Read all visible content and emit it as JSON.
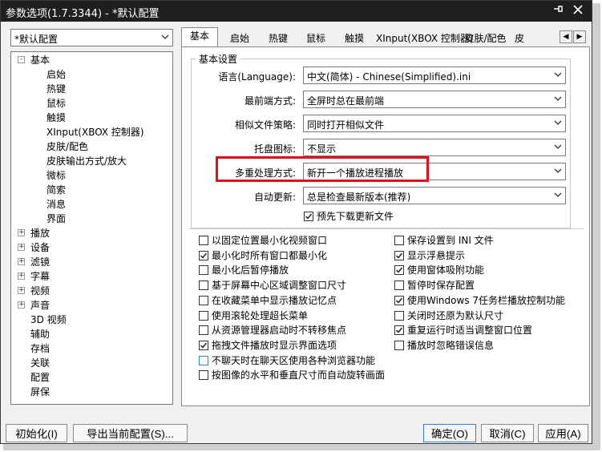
{
  "window": {
    "title": "参数选项(1.7.3344) - *默认配置",
    "pin_glyph": "‑❙",
    "close_glyph": "✕"
  },
  "profile": {
    "value": "*默认配置"
  },
  "tree": {
    "items": [
      {
        "label": "基本",
        "expander": "-",
        "level": 0
      },
      {
        "label": "启始",
        "level": 1
      },
      {
        "label": "热键",
        "level": 1
      },
      {
        "label": "鼠标",
        "level": 1
      },
      {
        "label": "触摸",
        "level": 1
      },
      {
        "label": "XInput(XBOX 控制器)",
        "level": 1
      },
      {
        "label": "皮肤/配色",
        "level": 1
      },
      {
        "label": "皮肤输出方式/放大",
        "level": 1
      },
      {
        "label": "微标",
        "level": 1
      },
      {
        "label": "简索",
        "level": 1
      },
      {
        "label": "消息",
        "level": 1
      },
      {
        "label": "界面",
        "level": 1
      },
      {
        "label": "播放",
        "expander": "+",
        "level": 0
      },
      {
        "label": "设备",
        "expander": "+",
        "level": 0
      },
      {
        "label": "滤镜",
        "expander": "+",
        "level": 0
      },
      {
        "label": "字幕",
        "expander": "+",
        "level": 0
      },
      {
        "label": "视频",
        "expander": "+",
        "level": 0
      },
      {
        "label": "声音",
        "expander": "+",
        "level": 0
      },
      {
        "label": "3D 视频",
        "level": 0
      },
      {
        "label": "辅助",
        "level": 0
      },
      {
        "label": "存档",
        "level": 0
      },
      {
        "label": "关联",
        "level": 0
      },
      {
        "label": "配置",
        "level": 0
      },
      {
        "label": "屏保",
        "level": 0
      }
    ]
  },
  "tabs": [
    {
      "label": "基本",
      "active": true
    },
    {
      "label": "启始"
    },
    {
      "label": "热键"
    },
    {
      "label": "鼠标"
    },
    {
      "label": "触摸"
    },
    {
      "label": "XInput(XBOX 控制器)"
    },
    {
      "label": "皮肤/配色"
    },
    {
      "label": "皮"
    }
  ],
  "tabnav": {
    "prev": "◀",
    "next": "▶"
  },
  "basic": {
    "group_title": "基本设置",
    "fields": [
      {
        "label": "语言(Language):",
        "value": "中文(简体) - Chinese(Simplified).ini"
      },
      {
        "label": "最前端方式:",
        "value": "全屏时总在最前端"
      },
      {
        "label": "相似文件策略:",
        "value": "同时打开相似文件"
      },
      {
        "label": "托盘图标:",
        "value": "不显示"
      },
      {
        "label": "多重处理方式:",
        "value": "新开一个播放进程播放"
      },
      {
        "label": "自动更新:",
        "value": "总是检查最新版本(推荐)"
      }
    ],
    "predownload": {
      "label": "预先下载更新文件",
      "checked": true
    }
  },
  "options_left": [
    {
      "label": "以固定位置最小化视频窗口",
      "checked": false
    },
    {
      "label": "最小化时所有窗口都最小化",
      "checked": true
    },
    {
      "label": "最小化后暂停播放",
      "checked": false
    },
    {
      "label": "基于屏幕中心区域调整窗口尺寸",
      "checked": false
    },
    {
      "label": "在收藏菜单中显示播放记忆点",
      "checked": false
    },
    {
      "label": "使用滚轮处理超长菜单",
      "checked": false
    },
    {
      "label": "从资源管理器启动时不转移焦点",
      "checked": false
    },
    {
      "label": "拖拽文件播放时显示界面选项",
      "checked": true
    },
    {
      "label": "不聊天时在聊天区使用各种浏览器功能",
      "checked": false
    },
    {
      "label": "按图像的水平和垂直尺寸而自动旋转画面",
      "checked": false
    }
  ],
  "options_right": [
    {
      "label": "保存设置到 INI 文件",
      "checked": false
    },
    {
      "label": "显示浮悬提示",
      "checked": true
    },
    {
      "label": "使用窗体吸附功能",
      "checked": true
    },
    {
      "label": "暂停时保存配置",
      "checked": false
    },
    {
      "label": "使用Windows 7任务栏播放控制功能",
      "checked": true
    },
    {
      "label": "关闭时还原为默认尺寸",
      "checked": false
    },
    {
      "label": "重复运行时适当调整窗口位置",
      "checked": true
    },
    {
      "label": "播放时忽略错误信息",
      "checked": false
    }
  ],
  "buttons": {
    "reset": "初始化(I)",
    "export": "导出当前配置(S)...",
    "ok": "确定(O)",
    "cancel": "取消(C)",
    "apply": "应用(A)"
  },
  "colors": {
    "highlight": "#e0101c",
    "titlebar": "#1f1f1f",
    "focus": "#3a7bd5"
  }
}
